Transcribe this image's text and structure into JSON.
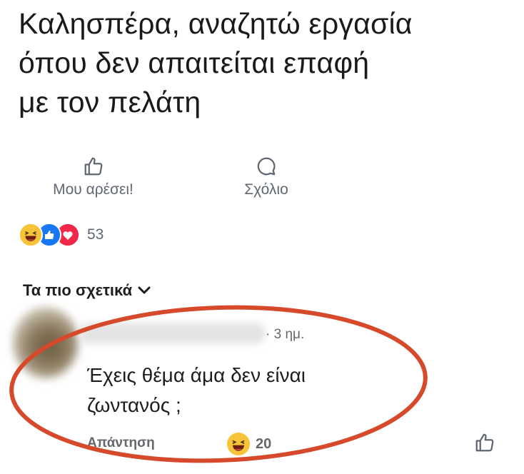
{
  "post": {
    "text": "Καλησπέρα, αναζητώ εργασία\nόπου δεν απαιτείται επαφή\nμε τον πελάτη"
  },
  "actions": {
    "like_label": "Μου αρέσει!",
    "comment_label": "Σχόλιο"
  },
  "reactions": {
    "count": "53",
    "types": [
      "haha",
      "like",
      "love"
    ]
  },
  "comments": {
    "sort_label": "Τα πιο σχετικά",
    "items": [
      {
        "time": "· 3 ημ.",
        "text": "Έχεις θέμα άμα δεν είναι\nζωντανός ;",
        "reply_label": "Απάντηση",
        "reaction_count": "20",
        "reaction_type": "haha"
      }
    ]
  },
  "colors": {
    "highlight": "#d64a2b",
    "haha": "#f7c339",
    "like": "#1877f2",
    "love": "#f02849"
  }
}
